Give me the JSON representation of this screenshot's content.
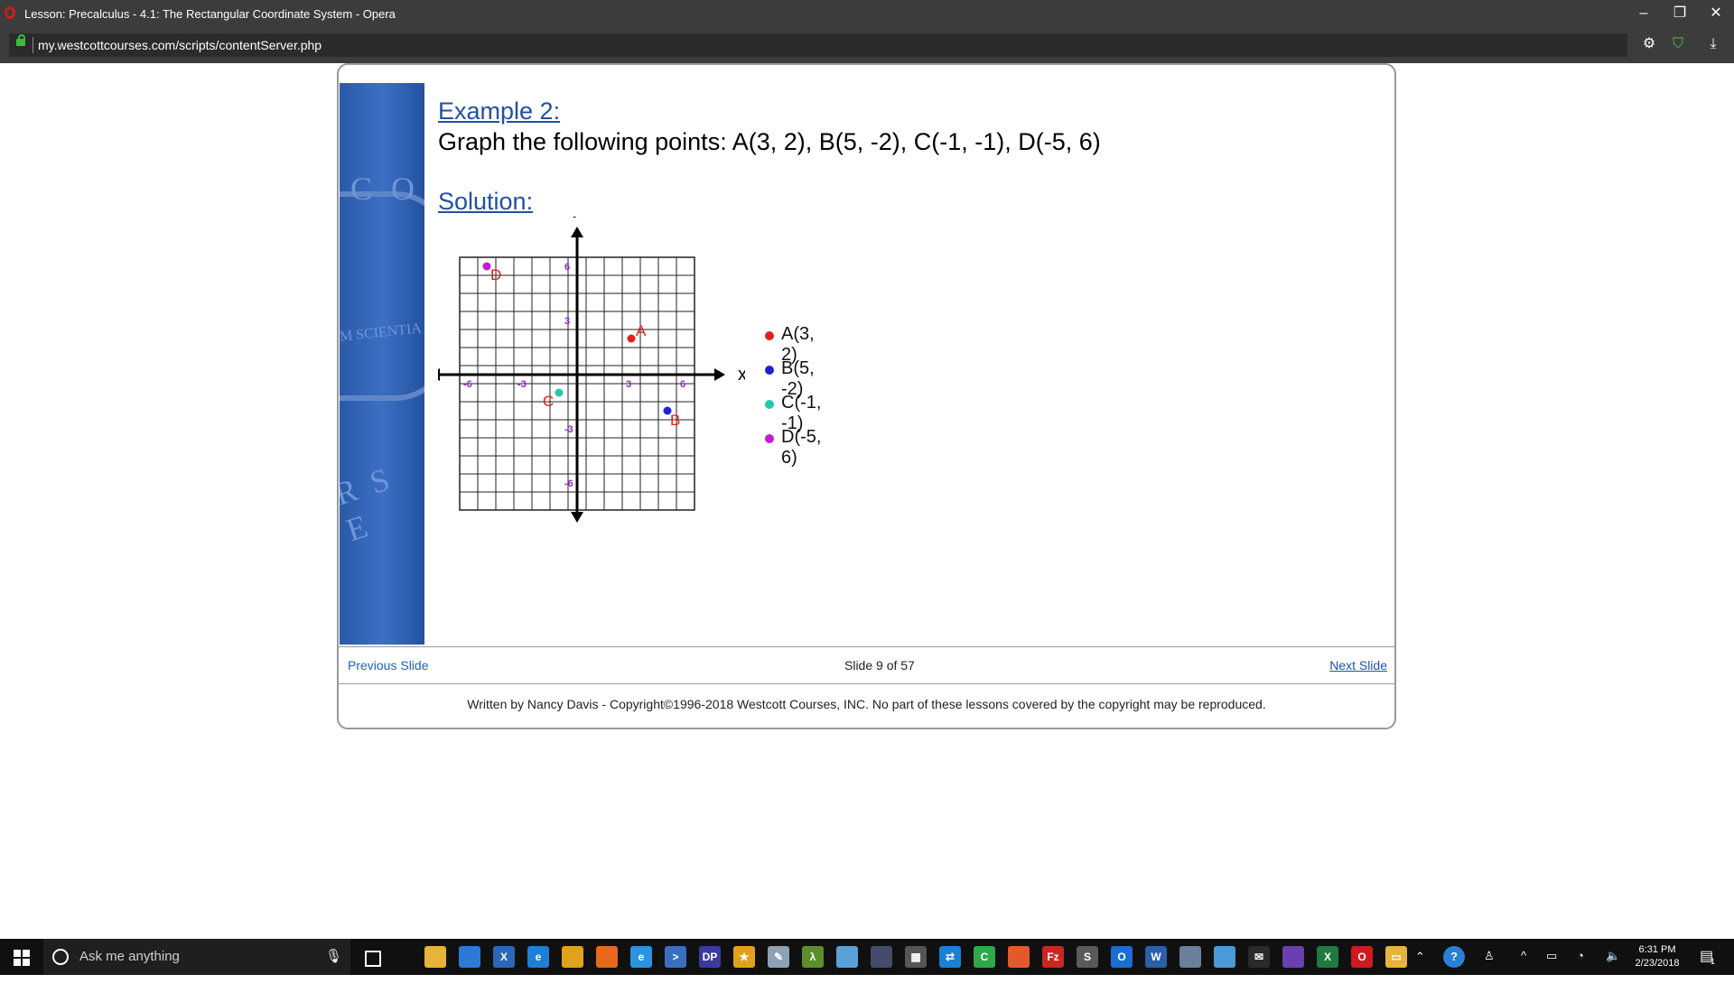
{
  "browser": {
    "window_title": "Lesson: Precalculus - 4.1: The Rectangular Coordinate System - Opera",
    "url": "my.westcottcourses.com/scripts/contentServer.php",
    "controls": {
      "minimize": "–",
      "restore": "❐",
      "close": "✕"
    },
    "toolbar_icons": [
      "gear-icon",
      "shield-check-icon",
      "download-icon"
    ]
  },
  "lesson": {
    "example_heading": "Example 2:",
    "instruction": "Graph the following points:  A(3, 2),  B(5, -2),  C(-1, -1),  D(-5, 6)",
    "solution_heading": "Solution:",
    "banner_text": {
      "top": "C O",
      "middle": "M SCIENTIA",
      "bottom": "R S E"
    }
  },
  "chart_data": {
    "type": "scatter",
    "title": "",
    "xlabel": "x",
    "ylabel": "y",
    "xlim": [
      -7,
      7
    ],
    "ylim": [
      -7,
      7
    ],
    "grid": true,
    "x_ticks": [
      "-6",
      "-3",
      "3",
      "6"
    ],
    "y_ticks": [
      "6",
      "3",
      "-3",
      "-6"
    ],
    "points": [
      {
        "label": "A",
        "x": 3,
        "y": 2,
        "color": "#e02020"
      },
      {
        "label": "B",
        "x": 5,
        "y": -2,
        "color": "#1a24d6"
      },
      {
        "label": "C",
        "x": -1,
        "y": -1,
        "color": "#26c7b0"
      },
      {
        "label": "D",
        "x": -5,
        "y": 6,
        "color": "#c61ad6"
      }
    ],
    "label_color": "#e02020",
    "tick_color": "#8a2cc4"
  },
  "legend": [
    {
      "text": "A(3, 2)",
      "color": "#e02020"
    },
    {
      "text": "B(5, -2)",
      "color": "#1a24d6"
    },
    {
      "text": "C(-1, -1)",
      "color": "#26c7b0"
    },
    {
      "text": "D(-5, 6)",
      "color": "#c61ad6"
    }
  ],
  "navigation": {
    "previous": "Previous Slide",
    "slide_count": "Slide 9 of 57",
    "next": "Next Slide"
  },
  "footer": {
    "copyright": "Written by Nancy Davis - Copyright©1996-2018 Westcott Courses, INC. No part of these lessons covered by the copyright may be reproduced."
  },
  "taskbar": {
    "search_placeholder": "Ask me anything",
    "time": "6:31 PM",
    "date": "2/23/2018",
    "notification_count": "1",
    "apps": [
      {
        "name": "file-explorer-icon",
        "glyph": "",
        "color": "#e8b33a"
      },
      {
        "name": "store-icon",
        "glyph": "",
        "color": "#2d7ad6"
      },
      {
        "name": "unknown-x-app-icon",
        "glyph": "X",
        "color": "#2a67b8"
      },
      {
        "name": "edge-icon",
        "glyph": "e",
        "color": "#1f7fd6"
      },
      {
        "name": "chrome-icon",
        "glyph": "",
        "color": "#e0a21c"
      },
      {
        "name": "firefox-icon",
        "glyph": "",
        "color": "#e8681c"
      },
      {
        "name": "internet-explorer-icon",
        "glyph": "e",
        "color": "#2c93e0"
      },
      {
        "name": "powershell-icon",
        "glyph": ">",
        "color": "#3a6fbf"
      },
      {
        "name": "dp-app-icon",
        "glyph": "DP",
        "color": "#3b3b9f"
      },
      {
        "name": "star-app-icon",
        "glyph": "★",
        "color": "#e0a21c"
      },
      {
        "name": "tools-app-icon",
        "glyph": "✎",
        "color": "#8fa1b5"
      },
      {
        "name": "lambda-app-icon",
        "glyph": "λ",
        "color": "#5c8f2b"
      },
      {
        "name": "notes-app-icon",
        "glyph": "",
        "color": "#5aa0d8"
      },
      {
        "name": "media-app-icon",
        "glyph": "",
        "color": "#444b6b"
      },
      {
        "name": "calculator-icon",
        "glyph": "▦",
        "color": "#555555"
      },
      {
        "name": "teamviewer-icon",
        "glyph": "⇄",
        "color": "#1b7fd6"
      },
      {
        "name": "camtasia-icon",
        "glyph": "C",
        "color": "#2fa84a"
      },
      {
        "name": "snip-app-icon",
        "glyph": "",
        "color": "#e25a2b"
      },
      {
        "name": "filezilla-icon",
        "glyph": "Fz",
        "color": "#c8281e"
      },
      {
        "name": "sublime-icon",
        "glyph": "S",
        "color": "#5a5a5a"
      },
      {
        "name": "outlook-icon",
        "glyph": "O",
        "color": "#1a6ed0"
      },
      {
        "name": "word-icon",
        "glyph": "W",
        "color": "#2b5fa8"
      },
      {
        "name": "network-app-icon",
        "glyph": "",
        "color": "#6a7f9a"
      },
      {
        "name": "remote-desktop-icon",
        "glyph": "",
        "color": "#4a9ad8"
      },
      {
        "name": "mail-icon",
        "glyph": "✉",
        "color": "#2a2a2a"
      },
      {
        "name": "visual-studio-icon",
        "glyph": "",
        "color": "#6a3fb0"
      },
      {
        "name": "excel-icon",
        "glyph": "X",
        "color": "#1f7a3f"
      },
      {
        "name": "opera-icon",
        "glyph": "O",
        "color": "#cc1b21"
      },
      {
        "name": "slides-app-icon",
        "glyph": "▭",
        "color": "#e8b33a"
      }
    ]
  }
}
